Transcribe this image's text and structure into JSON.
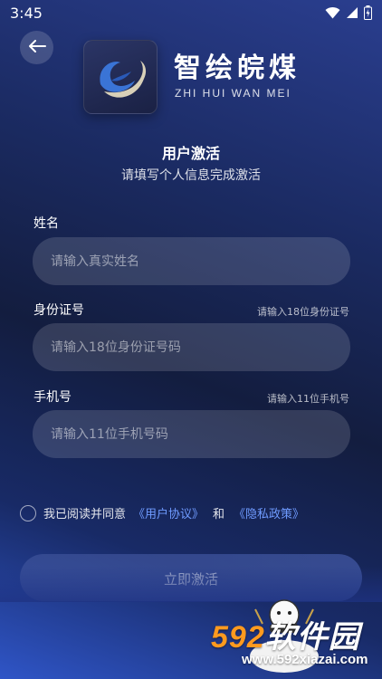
{
  "status_bar": {
    "time": "3:45",
    "icons": [
      "wifi-icon",
      "signal-icon",
      "battery-icon"
    ]
  },
  "header": {
    "back_icon": "arrow-left-icon",
    "brand_title": "智绘皖煤",
    "brand_subtitle": "ZHI HUI WAN MEI"
  },
  "page": {
    "title": "用户激活",
    "subtitle": "请填写个人信息完成激活"
  },
  "form": {
    "name": {
      "label": "姓名",
      "placeholder": "请输入真实姓名",
      "value": ""
    },
    "id_card": {
      "label": "身份证号",
      "hint": "请输入18位身份证号",
      "placeholder": "请输入18位身份证号码",
      "value": ""
    },
    "phone": {
      "label": "手机号",
      "hint": "请输入11位手机号",
      "placeholder": "请输入11位手机号码",
      "value": ""
    }
  },
  "agreement": {
    "checked": false,
    "prefix": "我已阅读并同意",
    "user_agreement": "《用户协议》",
    "and": "和",
    "privacy_policy": "《隐私政策》"
  },
  "submit": {
    "label": "立即激活"
  },
  "watermark": {
    "brand_number": "592",
    "brand_text": "软件园",
    "url": "www.592xiazai.com"
  },
  "colors": {
    "link": "#6f9bff",
    "watermark_accent": "#ff9a1f"
  }
}
